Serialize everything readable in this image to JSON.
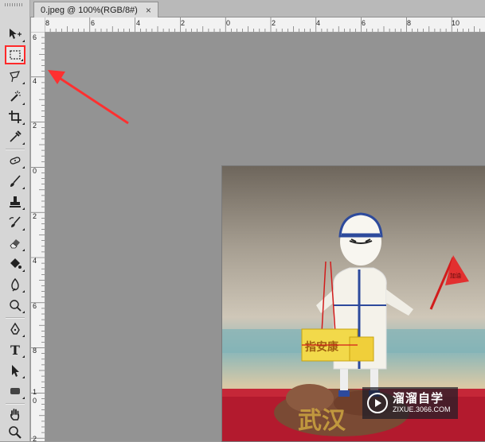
{
  "document": {
    "tab_title": "0.jpeg @ 100%(RGB/8#)",
    "close_glyph": "×"
  },
  "rulers": {
    "horizontal_labels": [
      "8",
      "6",
      "4",
      "2",
      "0",
      "2",
      "4",
      "6",
      "8",
      "10"
    ],
    "vertical_labels": [
      "6",
      "4",
      "2",
      "0",
      "2",
      "4",
      "6",
      "8",
      "1",
      "0",
      "2"
    ]
  },
  "toolbar": {
    "tools": [
      "move-tool",
      "rectangular-marquee-tool",
      "lasso-tool",
      "magic-wand-tool",
      "crop-tool",
      "eyedropper-tool",
      "spot-healing-tool",
      "brush-tool",
      "clone-stamp-tool",
      "history-brush-tool",
      "eraser-tool",
      "paint-bucket-tool",
      "blur-tool",
      "dodge-tool",
      "pen-tool",
      "type-tool",
      "path-selection-tool",
      "rectangle-tool",
      "hand-tool",
      "zoom-tool"
    ],
    "type_tool_glyph": "T",
    "active_tool": "rectangular-marquee-tool",
    "highlight_color": "#ff2a2a"
  },
  "annotation": {
    "arrow_color": "#ff3030"
  },
  "photo": {
    "banner_text": "武汉",
    "flag_text": "加油",
    "box_text": "指安康"
  },
  "watermark": {
    "title": "溜溜自学",
    "url": "ZIXUE.3066.COM"
  }
}
